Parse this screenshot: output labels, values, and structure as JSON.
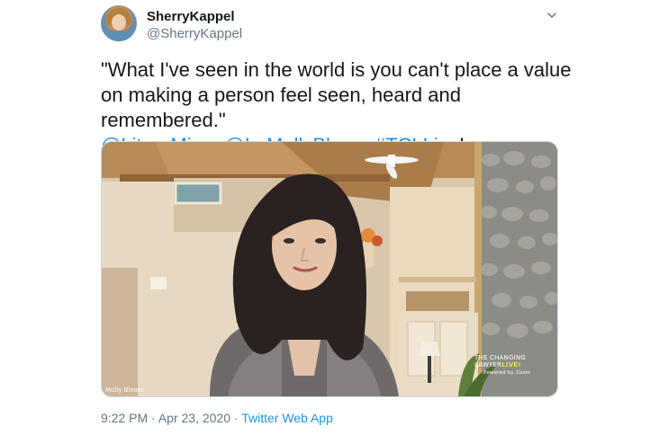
{
  "author": {
    "display_name": "SherryKappel",
    "handle": "@SherryKappel"
  },
  "tweet": {
    "quote": "\"What I've seen in the world is you can't place a value on making a person feel seen, heard and remembered.\"",
    "mentions": [
      "@LiteraMicro",
      "@ImMollyBloom"
    ],
    "hashtag": "#TCLLive",
    "trailing": "!"
  },
  "media": {
    "speaker_caption": "Molly Bloom",
    "brand_line1": "THE CHANGING",
    "brand_line2a": "LAWYER",
    "brand_line2b": "LIVE!",
    "brand_powered": "Powered by Zoom"
  },
  "meta": {
    "time": "9:22 PM",
    "separator": "·",
    "date": "Apr 23, 2020",
    "source": "Twitter Web App"
  },
  "icons": {
    "menu": "chevron-down-icon"
  },
  "colors": {
    "link": "#1b95e0",
    "text": "#14171a",
    "secondary": "#657786",
    "brand_live": "#e8e23a"
  }
}
